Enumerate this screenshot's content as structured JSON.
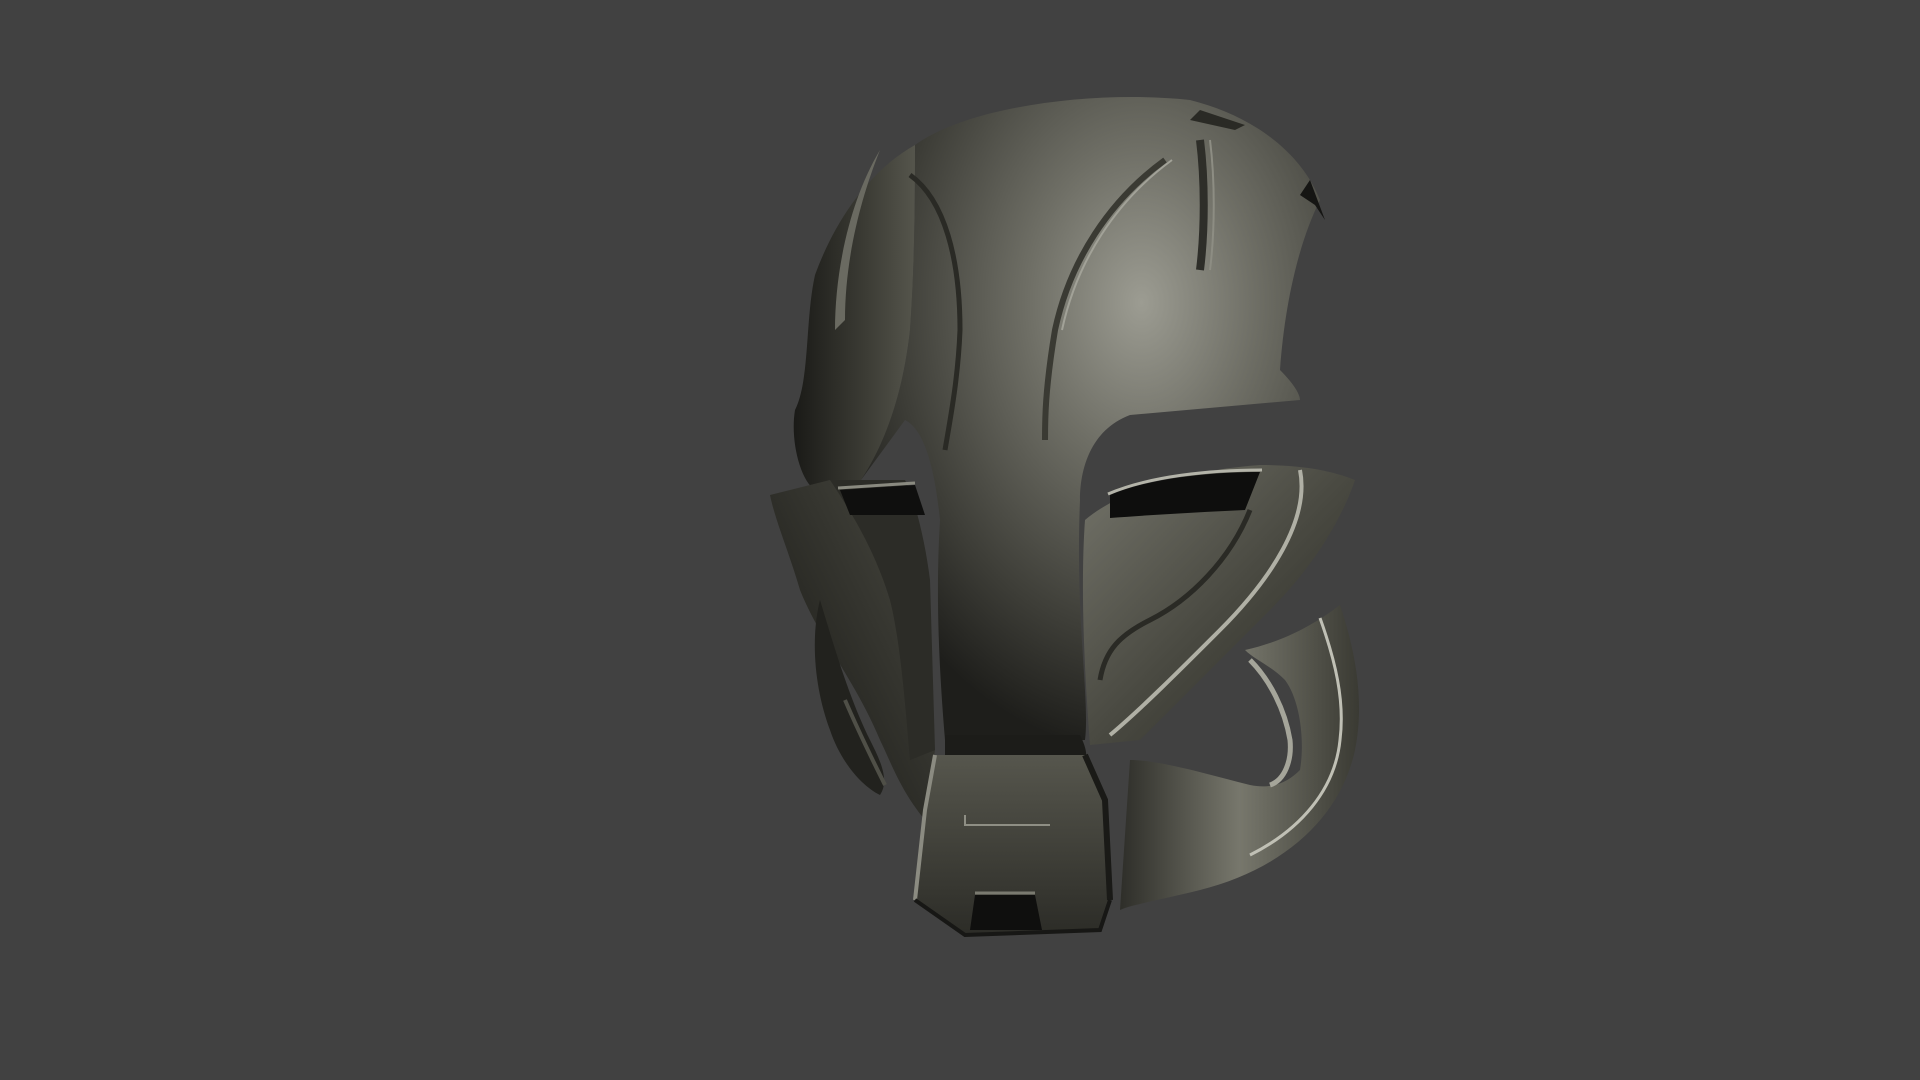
{
  "viewport": {
    "background_color": "#414141",
    "subject": "helmet-model",
    "material_colors": {
      "highlight": "#9a9a90",
      "mid": "#5e5e55",
      "dark": "#2b2b26",
      "deep": "#111110",
      "edge": "#b9b9ae"
    }
  }
}
